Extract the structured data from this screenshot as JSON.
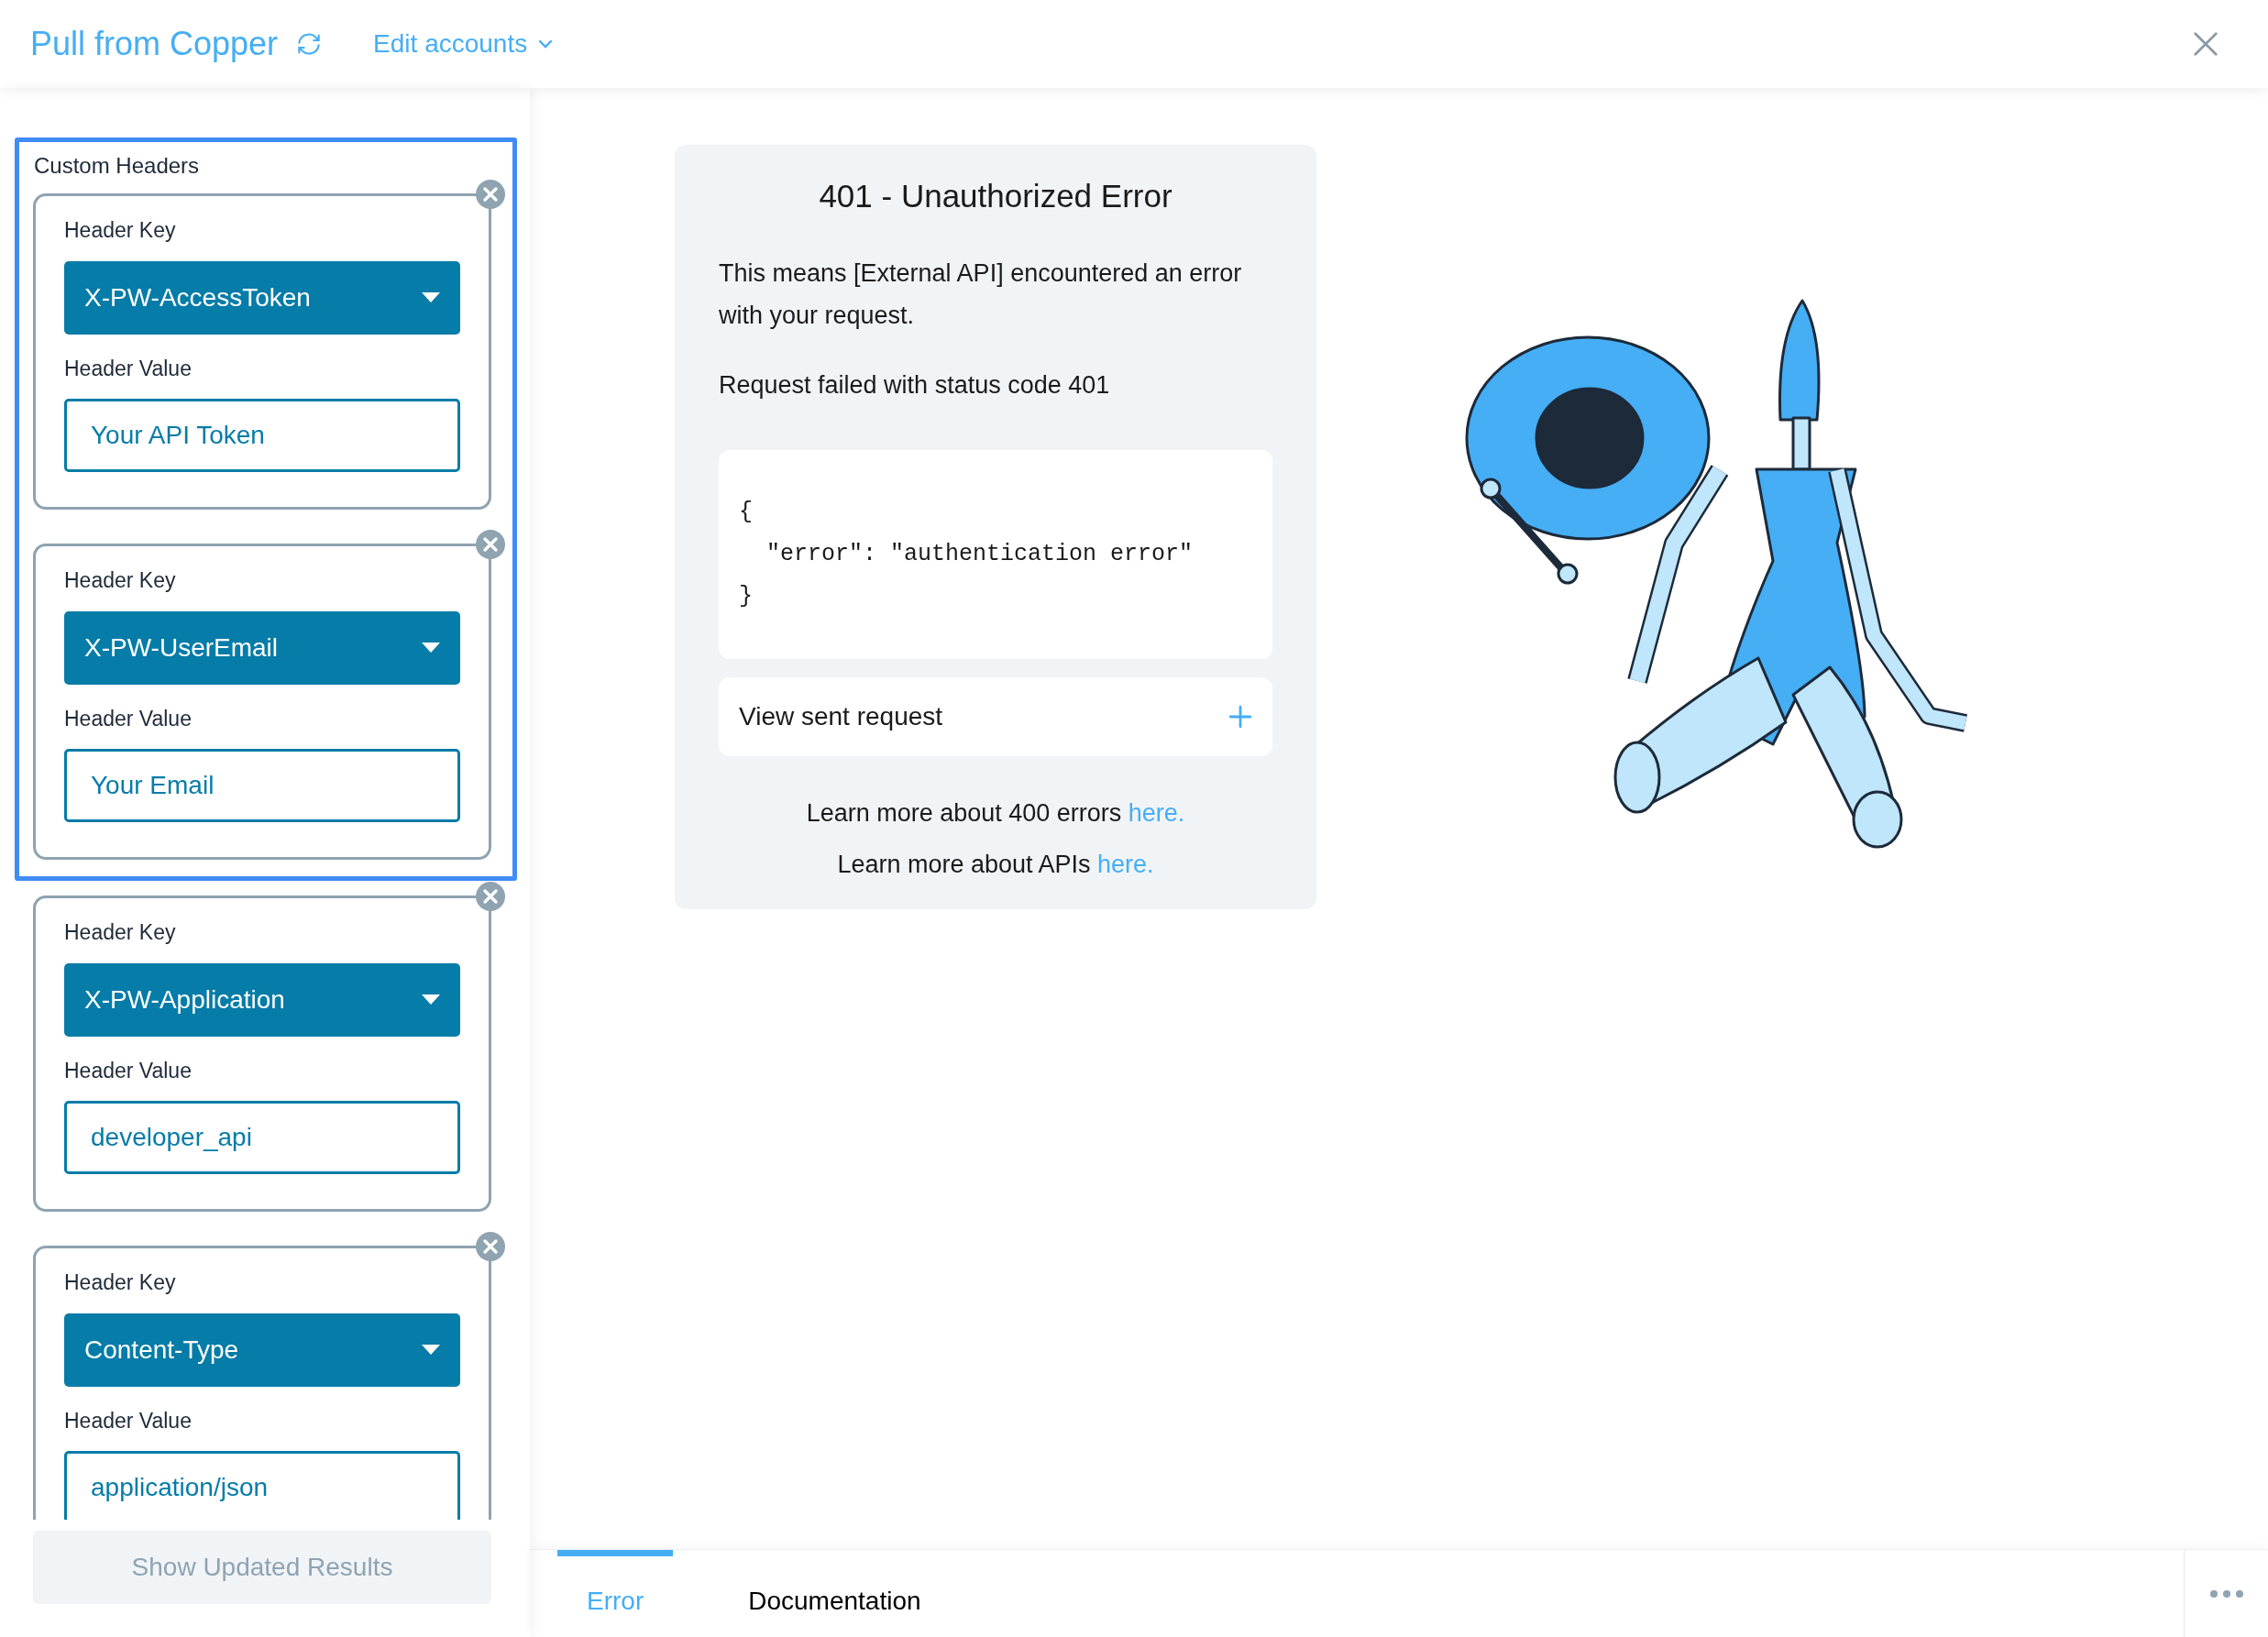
{
  "header": {
    "title": "Pull from Copper",
    "edit_accounts": "Edit accounts"
  },
  "custom_headers": {
    "label": "Custom Headers",
    "outlined_items": [
      {
        "key_label": "Header Key",
        "key": "X-PW-AccessToken",
        "value_label": "Header Value",
        "value": "Your API Token"
      },
      {
        "key_label": "Header Key",
        "key": "X-PW-UserEmail",
        "value_label": "Header Value",
        "value": "Your Email"
      }
    ],
    "more_items": [
      {
        "key_label": "Header Key",
        "key": "X-PW-Application",
        "value_label": "Header Value",
        "value": "developer_api"
      },
      {
        "key_label": "Header Key",
        "key": "Content-Type",
        "value_label": "Header Value",
        "value": "application/json"
      }
    ]
  },
  "show_button": {
    "label": "Show Updated Results",
    "disabled": true
  },
  "error_card": {
    "title": "401 - Unauthorized Error",
    "paragraphs": [
      "This means [External API] encountered an error with your request.",
      "Request failed with status code 401"
    ],
    "code_lines": [
      "{",
      "  \"error\": \"authentication error\"",
      "}"
    ],
    "view_sent_request": "View sent request",
    "links": [
      {
        "text": "Learn more about 400 errors",
        "link": "here."
      },
      {
        "text": "Learn more about APIs",
        "link": "here."
      }
    ]
  },
  "tabs": [
    {
      "label": "Error",
      "selected": true
    },
    {
      "label": "Documentation",
      "selected": false
    }
  ]
}
